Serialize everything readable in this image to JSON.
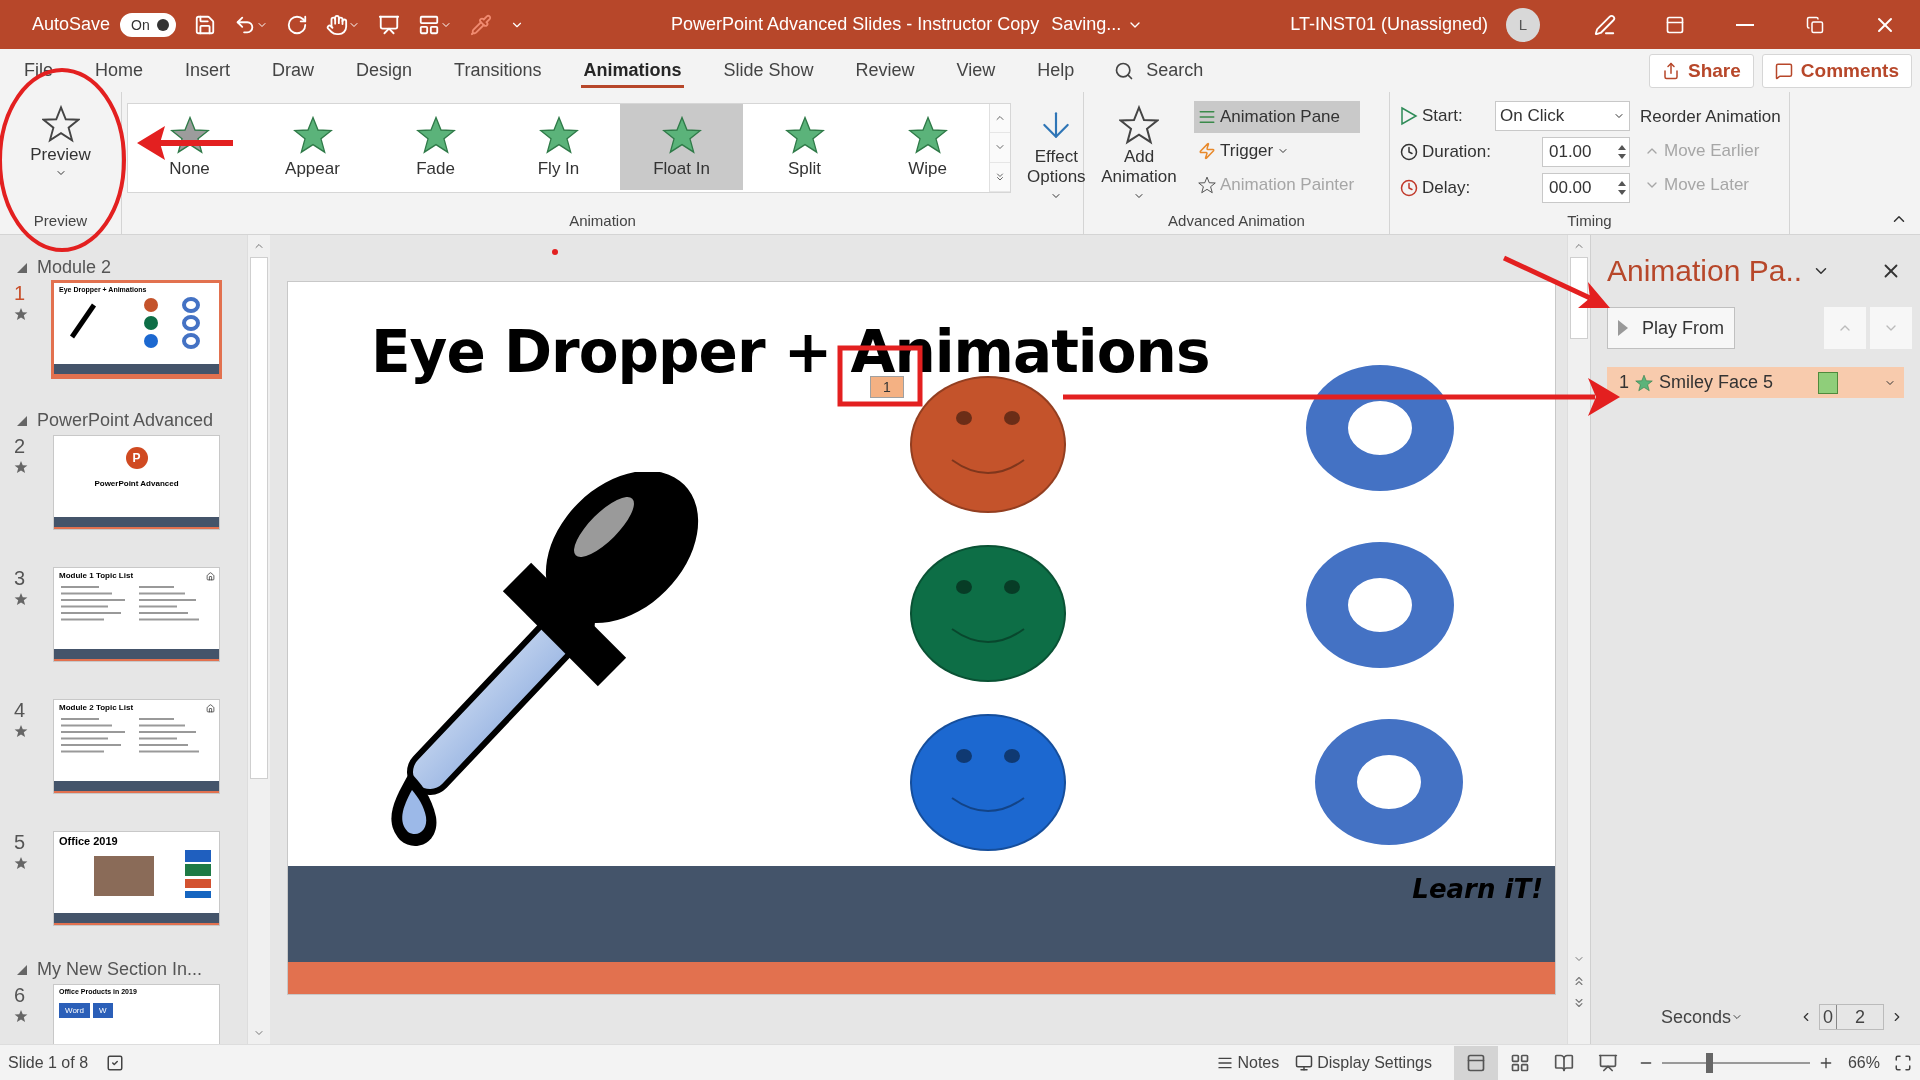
{
  "title_bar": {
    "autosave_label": "AutoSave",
    "autosave_on": true,
    "autosave_state": "On",
    "document_title": "PowerPoint Advanced Slides - Instructor Copy",
    "save_status": "Saving...",
    "account": "LT-INST01 (Unassigned)",
    "avatar_initial": "L"
  },
  "ribbon_tabs": [
    {
      "label": "File",
      "selected": false
    },
    {
      "label": "Home",
      "selected": false
    },
    {
      "label": "Insert",
      "selected": false
    },
    {
      "label": "Draw",
      "selected": false
    },
    {
      "label": "Design",
      "selected": false
    },
    {
      "label": "Transitions",
      "selected": false
    },
    {
      "label": "Animations",
      "selected": true
    },
    {
      "label": "Slide Show",
      "selected": false
    },
    {
      "label": "Review",
      "selected": false
    },
    {
      "label": "View",
      "selected": false
    },
    {
      "label": "Help",
      "selected": false
    }
  ],
  "search": {
    "placeholder": "Search"
  },
  "share_button": "Share",
  "comments_button": "Comments",
  "ribbon": {
    "preview": {
      "button": "Preview",
      "group_label": "Preview"
    },
    "animation": {
      "items": [
        {
          "label": "None",
          "kind": "none",
          "selected": false
        },
        {
          "label": "Appear",
          "kind": "effect",
          "selected": false
        },
        {
          "label": "Fade",
          "kind": "effect",
          "selected": false
        },
        {
          "label": "Fly In",
          "kind": "effect",
          "selected": false
        },
        {
          "label": "Float In",
          "kind": "effect",
          "selected": true
        },
        {
          "label": "Split",
          "kind": "effect",
          "selected": false
        },
        {
          "label": "Wipe",
          "kind": "effect",
          "selected": false
        }
      ],
      "effect_options": "Effect Options",
      "group_label": "Animation"
    },
    "advanced_animation": {
      "add_animation": "Add Animation",
      "animation_pane": {
        "label": "Animation Pane",
        "selected": true
      },
      "trigger": "Trigger",
      "animation_painter": {
        "label": "Animation Painter",
        "disabled": true
      },
      "group_label": "Advanced Animation"
    },
    "timing": {
      "start_label": "Start:",
      "start_value": "On Click",
      "duration_label": "Duration:",
      "duration_value": "01.00",
      "delay_label": "Delay:",
      "delay_value": "00.00",
      "reorder_label": "Reorder Animation",
      "move_earlier": {
        "label": "Move Earlier",
        "disabled": true
      },
      "move_later": {
        "label": "Move Later",
        "disabled": true
      },
      "group_label": "Timing"
    }
  },
  "slide_panel": {
    "sections": [
      {
        "name": "Module 2",
        "expanded": true,
        "slides": [
          {
            "number": "1",
            "selected": true,
            "kind": "eye-dropper",
            "title": "Eye Dropper + Animations"
          }
        ]
      },
      {
        "name": "PowerPoint Advanced",
        "expanded": true,
        "slides": [
          {
            "number": "2",
            "selected": false,
            "kind": "title",
            "title": "PowerPoint Advanced",
            "logo_letter": "P"
          },
          {
            "number": "3",
            "selected": false,
            "kind": "topics",
            "title": "Module 1 Topic List"
          },
          {
            "number": "4",
            "selected": false,
            "kind": "topics",
            "title": "Module 2 Topic List"
          },
          {
            "number": "5",
            "selected": false,
            "kind": "office",
            "title": "Office 2019"
          }
        ]
      },
      {
        "name": "My New Section In...",
        "expanded": true,
        "slides": [
          {
            "number": "6",
            "selected": false,
            "kind": "products",
            "title": "Office Products in 2019",
            "tiles": [
              "Word",
              "W"
            ]
          }
        ]
      }
    ]
  },
  "slide": {
    "title": "Eye Dropper + Animations",
    "animation_tag": "1",
    "faces": [
      {
        "color": "#c4532b"
      },
      {
        "color": "#0d6e46"
      },
      {
        "color": "#1c68d0"
      }
    ],
    "footer_text": "Learn iT!"
  },
  "animation_pane": {
    "title": "Animation Pa..",
    "play_from": "Play From",
    "items": [
      {
        "number": "1",
        "name": "Smiley Face 5",
        "selected": true
      }
    ],
    "time_unit": "Seconds",
    "timeline": [
      "0",
      "2"
    ]
  },
  "status_bar": {
    "slide_info": "Slide 1 of 8",
    "notes": "Notes",
    "display_settings": "Display Settings",
    "views": [
      {
        "kind": "normal",
        "selected": true
      },
      {
        "kind": "sorter",
        "selected": false
      },
      {
        "kind": "reading",
        "selected": false
      },
      {
        "kind": "slideshow",
        "selected": false
      }
    ],
    "zoom": {
      "level": 0.32,
      "reading": "66%"
    }
  }
}
